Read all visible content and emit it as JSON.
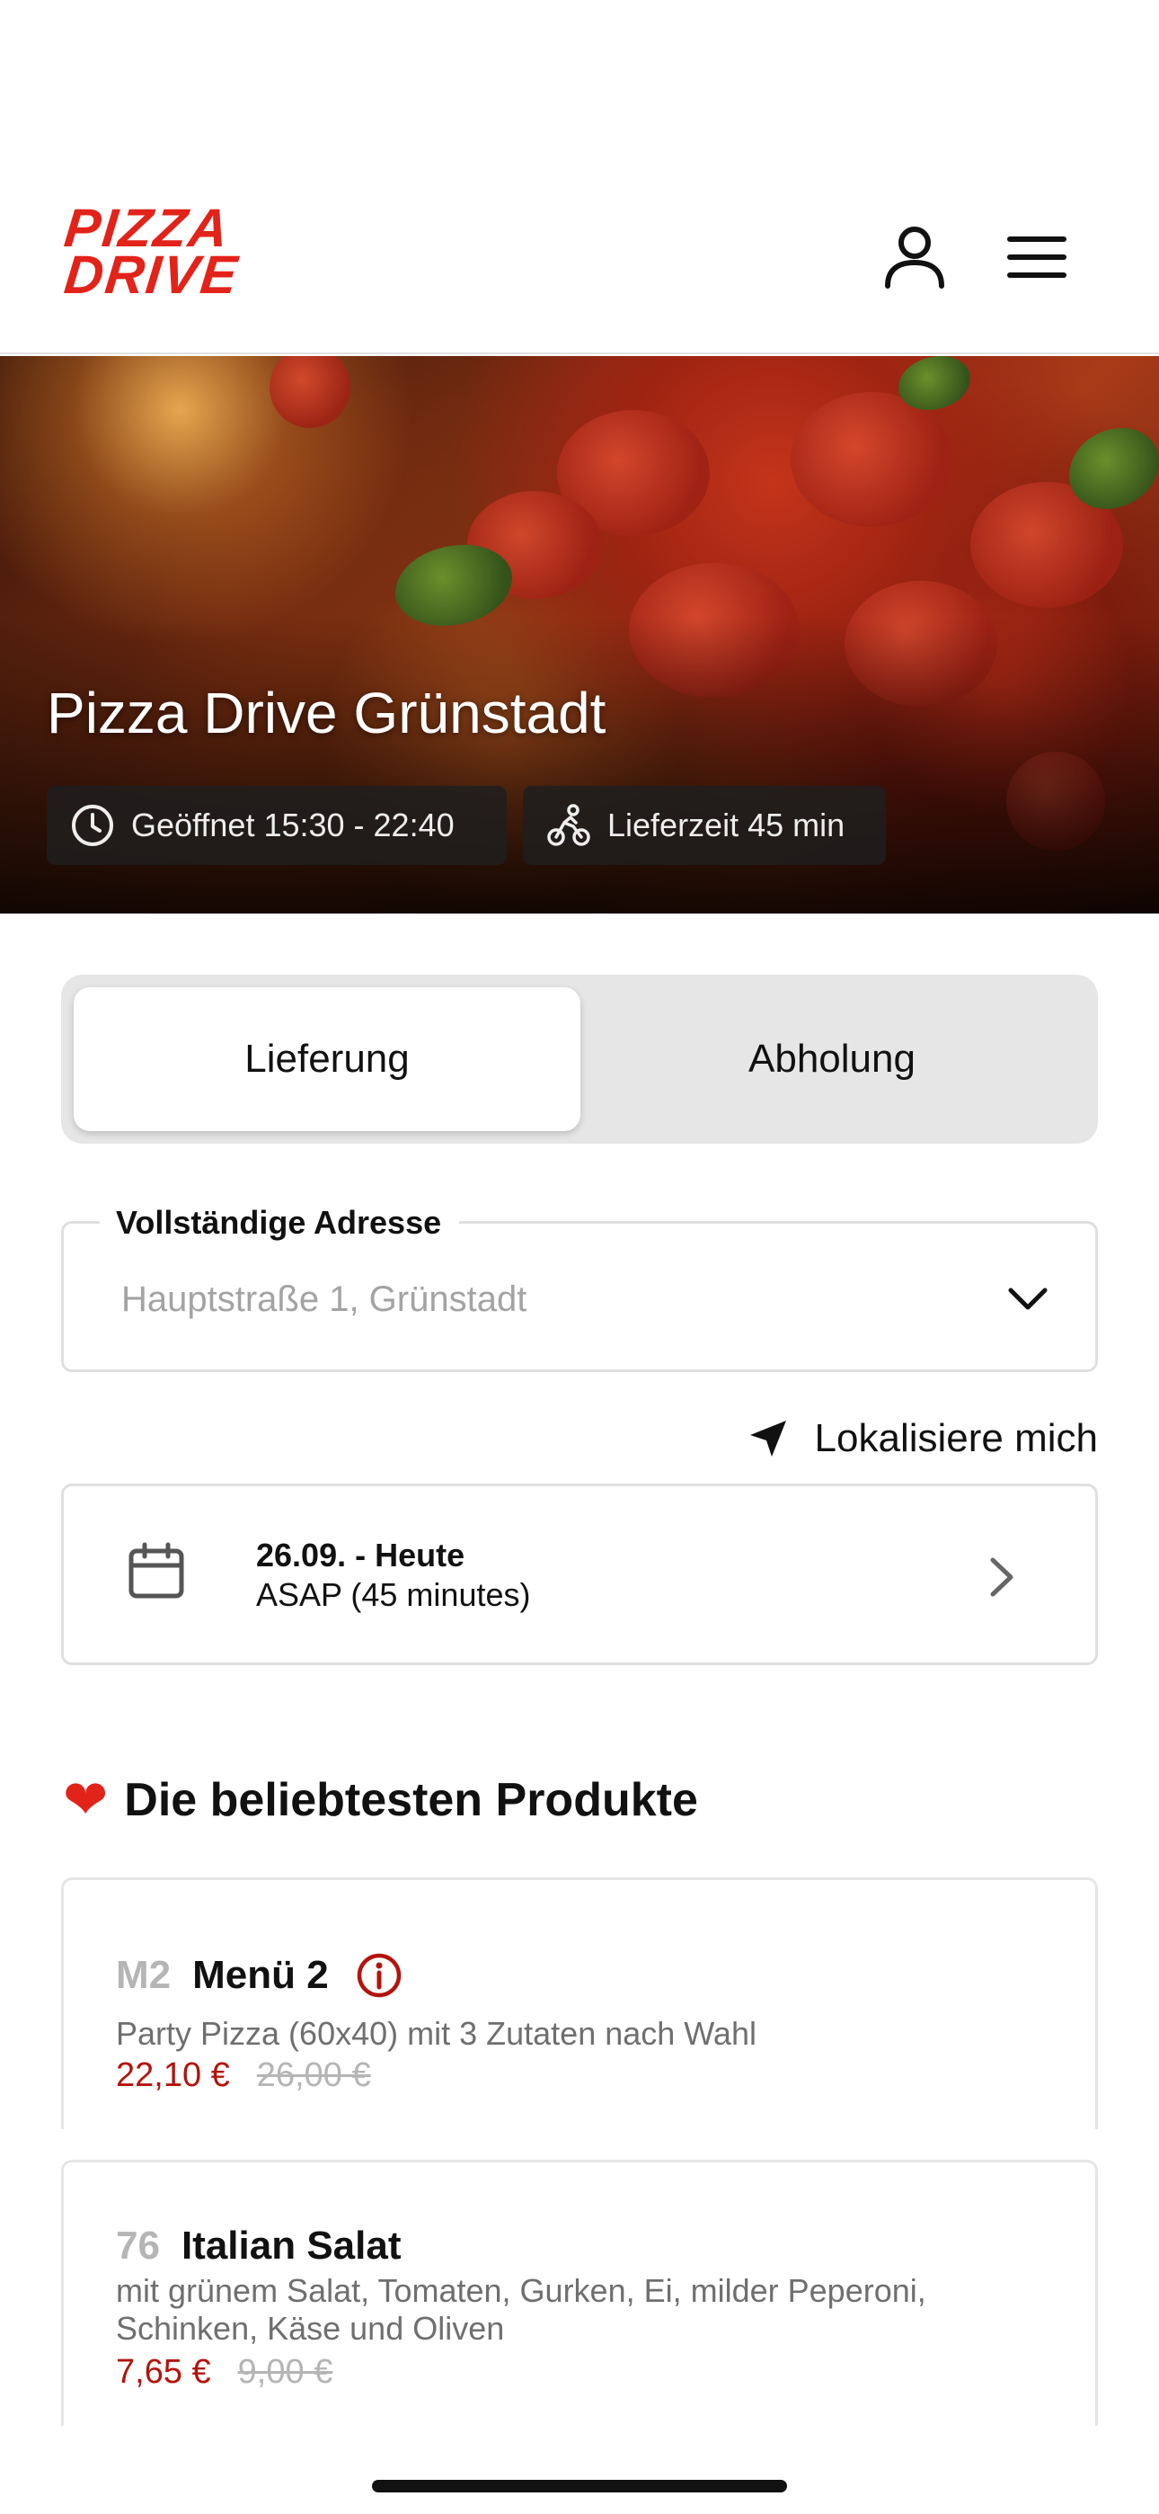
{
  "brand": {
    "logo_line1": "PIZZA",
    "logo_line2": "DRIVE",
    "color": "#e2231a"
  },
  "header": {
    "user_icon": "user-icon",
    "menu_icon": "hamburger-menu-icon"
  },
  "hero": {
    "title": "Pizza Drive Grünstadt",
    "opening_hours": "Geöffnet 15:30 - 22:40",
    "delivery_time": "Lieferzeit 45 min"
  },
  "order_mode": {
    "options": [
      "Lieferung",
      "Abholung"
    ],
    "selected": "Lieferung"
  },
  "address": {
    "label": "Vollständige Adresse",
    "placeholder": "Hauptstraße 1, Grünstadt"
  },
  "locate": {
    "label": "Lokalisiere mich"
  },
  "schedule": {
    "date": "26.09. - Heute",
    "time": "ASAP (45 minutes)"
  },
  "popular": {
    "title": "Die beliebtesten Produkte",
    "products": [
      {
        "number": "M2",
        "name": "Menü 2",
        "description": "Party Pizza (60x40) mit 3 Zutaten nach Wahl",
        "price": "22,10 €",
        "old_price": "26,00 €"
      },
      {
        "number": "76",
        "name": "Italian Salat",
        "description": "mit grünem Salat, Tomaten, Gurken, Ei, milder Peperoni, Schinken, Käse und Oliven",
        "price": "7,65 €",
        "old_price": "9,00 €"
      }
    ]
  },
  "colors": {
    "accent": "#e2231a",
    "price": "#b3140d",
    "muted": "#a3a3a3"
  }
}
